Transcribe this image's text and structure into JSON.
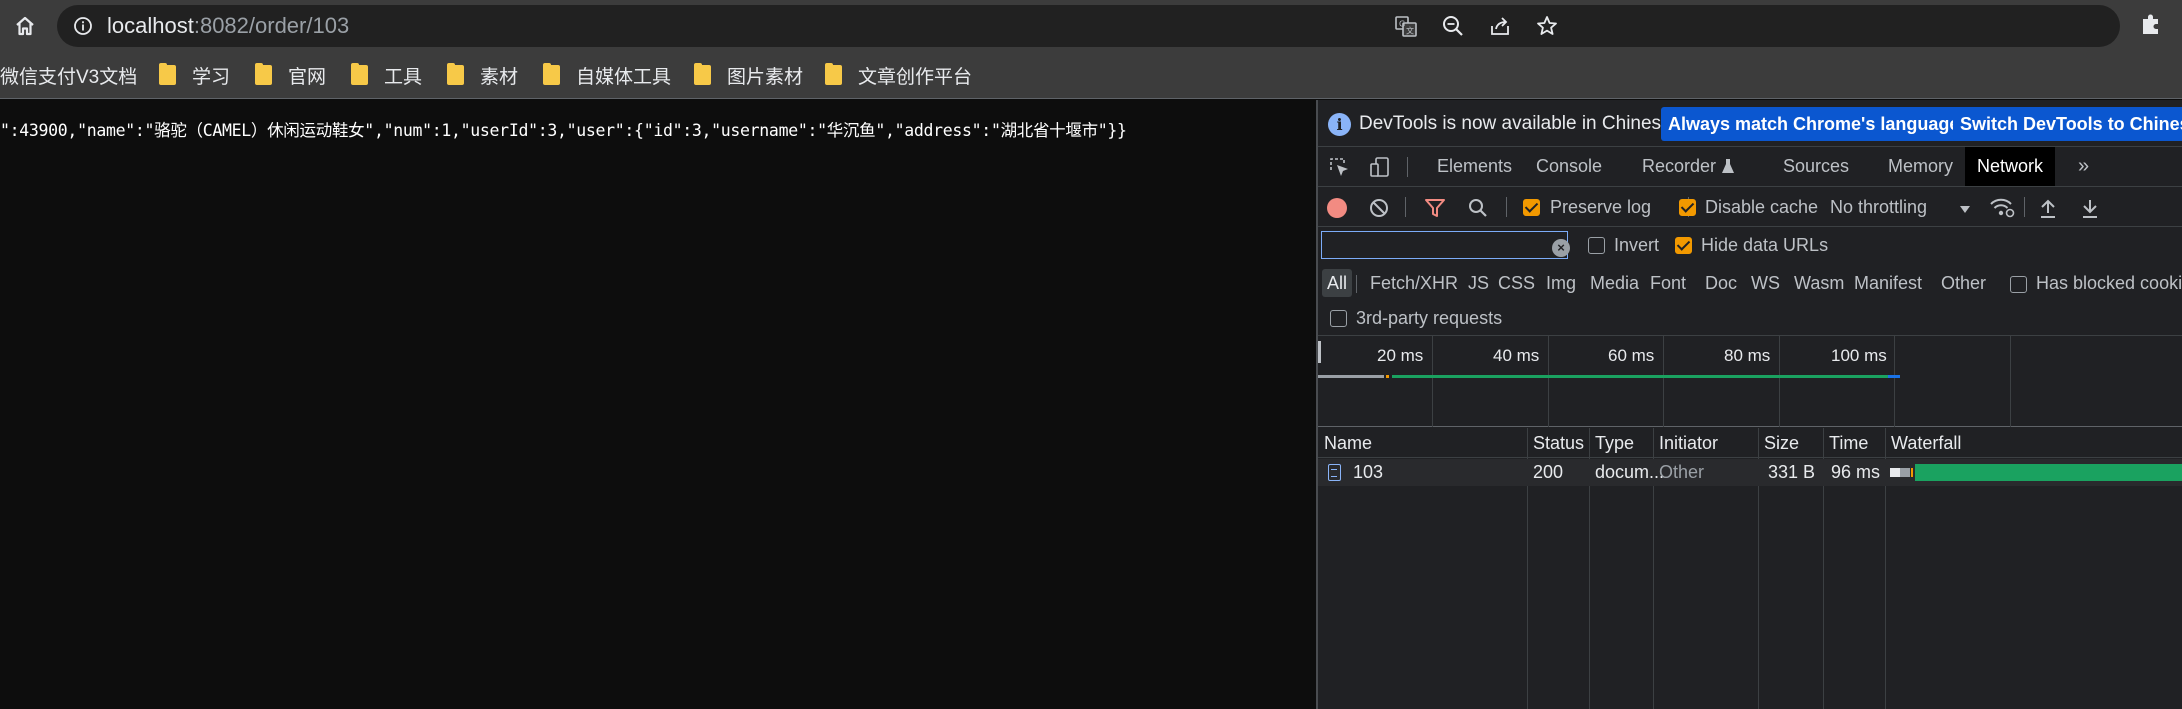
{
  "browser": {
    "url_host": "localhost",
    "url_rest": ":8082/order/103",
    "bookmarks": [
      "微信支付V3文档",
      "学习",
      "官网",
      "工具",
      "素材",
      "自媒体工具",
      "图片素材",
      "文章创作平台"
    ]
  },
  "page": {
    "json_text": "\":43900,\"name\":\"骆驼（CAMEL）休闲运动鞋女\",\"num\":1,\"userId\":3,\"user\":{\"id\":3,\"username\":\"华沉鱼\",\"address\":\"湖北省十堰市\"}}"
  },
  "devtools": {
    "info_message": "DevTools is now available in Chinese!",
    "btn_match_language": "Always match Chrome's language",
    "btn_switch_chinese": "Switch DevTools to Chinese",
    "tabs": [
      "Elements",
      "Console",
      "Recorder",
      "Sources",
      "Memory",
      "Network"
    ],
    "active_tab": "Network",
    "toolbar": {
      "preserve_log": "Preserve log",
      "preserve_log_checked": true,
      "disable_cache": "Disable cache",
      "disable_cache_checked": true,
      "throttling": "No throttling"
    },
    "filter": {
      "value": "",
      "invert": "Invert",
      "invert_checked": false,
      "hide_data_urls": "Hide data URLs",
      "hide_data_urls_checked": true
    },
    "type_filters": [
      "All",
      "Fetch/XHR",
      "JS",
      "CSS",
      "Img",
      "Media",
      "Font",
      "Doc",
      "WS",
      "Wasm",
      "Manifest",
      "Other"
    ],
    "active_type": "All",
    "has_blocked_cookies": "Has blocked cookies",
    "third_party": "3rd-party requests",
    "overview_ticks": [
      "20 ms",
      "40 ms",
      "60 ms",
      "80 ms",
      "100 ms"
    ],
    "columns": [
      "Name",
      "Status",
      "Type",
      "Initiator",
      "Size",
      "Time",
      "Waterfall"
    ],
    "rows": [
      {
        "name": "103",
        "status": "200",
        "type": "docum...",
        "initiator": "Other",
        "size": "331 B",
        "time": "96 ms"
      }
    ],
    "colors": {
      "accent": "#0b57d0",
      "checkbox": "#f29900",
      "record": "#f28b82",
      "waterfall_green": "#1aa260"
    }
  }
}
